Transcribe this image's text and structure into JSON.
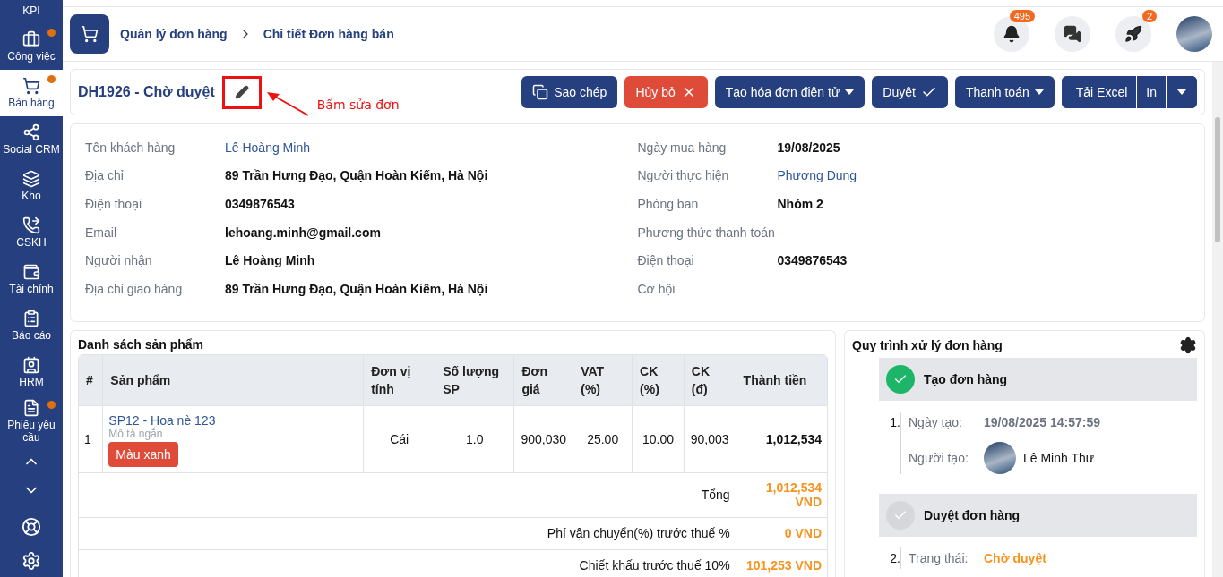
{
  "sidebar": {
    "items": [
      {
        "label": "KPI",
        "dot": false,
        "selected": false
      },
      {
        "label": "Công việc",
        "dot": true,
        "selected": false
      },
      {
        "label": "Bán hàng",
        "dot": true,
        "selected": true
      },
      {
        "label": "Social CRM",
        "dot": false,
        "selected": false
      },
      {
        "label": "Kho",
        "dot": false,
        "selected": false
      },
      {
        "label": "CSKH",
        "dot": false,
        "selected": false
      },
      {
        "label": "Tài chính",
        "dot": false,
        "selected": false
      },
      {
        "label": "Báo cáo",
        "dot": false,
        "selected": false
      },
      {
        "label": "HRM",
        "dot": false,
        "selected": false
      },
      {
        "label": "Phiếu yêu cầu",
        "dot": true,
        "selected": false
      }
    ]
  },
  "breadcrumb": [
    "Quản lý đơn hàng",
    "Chi tiết Đơn hàng bán"
  ],
  "header": {
    "notifications": "495",
    "rocket_count": "2"
  },
  "order": {
    "title": "DH1926 - Chờ duyệt",
    "annotation": "Bấm sửa đơn",
    "actions": [
      {
        "label": "Sao chép",
        "kind": "copy"
      },
      {
        "label": "Hủy bỏ",
        "kind": "cancel"
      },
      {
        "label": "Tạo hóa đơn điện tử",
        "kind": "dropdown"
      },
      {
        "label": "Duyệt",
        "kind": "approve"
      },
      {
        "label": "Thanh toán",
        "kind": "dropdown"
      }
    ],
    "export": [
      "Tải Excel",
      "In"
    ]
  },
  "info": {
    "left": [
      {
        "label": "Tên khách hàng",
        "value": "Lê Hoàng Minh",
        "kind": "link"
      },
      {
        "label": "Địa chỉ",
        "value": "89 Trần Hưng Đạo, Quận Hoàn Kiếm, Hà Nội",
        "kind": "bold"
      },
      {
        "label": "Điện thoại",
        "value": "0349876543",
        "kind": "bold"
      },
      {
        "label": "Email",
        "value": "lehoang.minh@gmail.com",
        "kind": "bold"
      },
      {
        "label": "Người nhận",
        "value": "Lê Hoàng Minh",
        "kind": "bold"
      },
      {
        "label": "Địa chỉ giao hàng",
        "value": "89 Trần Hưng Đạo, Quận Hoàn Kiếm, Hà Nội",
        "kind": "bold"
      }
    ],
    "right": [
      {
        "label": "Ngày mua hàng",
        "value": "19/08/2025",
        "kind": "bold"
      },
      {
        "label": "Người thực hiện",
        "value": "Phương Dung",
        "kind": "link"
      },
      {
        "label": "Phòng ban",
        "value": "Nhóm 2",
        "kind": "bold"
      },
      {
        "label": "Phương thức thanh toán",
        "kind": "empty"
      },
      {
        "label": "Điện thoại",
        "value": "0349876543",
        "kind": "bold"
      },
      {
        "label": "Cơ hội",
        "kind": "empty"
      }
    ]
  },
  "products": {
    "title": "Danh sách sản phẩm",
    "columns": [
      "#",
      "Sản phẩm",
      "Đơn vị tính",
      "Số lượng SP",
      "Đơn giá",
      "VAT (%)",
      "CK (%)",
      "CK (đ)",
      "Thành tiền"
    ],
    "rows": [
      {
        "index": "1",
        "name": "SP12 - Hoa nè 123",
        "description": "Mô tả ngắn",
        "tag": "Màu xanh",
        "unit": "Cái",
        "quantity": "1.0",
        "price": "900,030",
        "vat": "25.00",
        "discount_pct": "10.00",
        "discount_amount": "90,003",
        "total": "1,012,534"
      }
    ],
    "summary": [
      {
        "label": "Tổng",
        "value": "1,012,534 VND"
      },
      {
        "label": "Phí vận chuyển(%) trước thuế %",
        "value": "0 VND"
      },
      {
        "label": "Chiết khấu trước thuế 10%",
        "value": "101,253 VND"
      }
    ]
  },
  "process": {
    "title": "Quy trình xử lý đơn hàng",
    "steps": [
      {
        "title": "Tạo đơn hàng",
        "done": true,
        "number": "1.",
        "details": [
          {
            "label": "Ngày tạo:",
            "value": "19/08/2025 14:57:59",
            "kind": "date"
          },
          {
            "label": "Người tạo:",
            "value": "Lê Minh Thư",
            "kind": "person"
          }
        ]
      },
      {
        "title": "Duyệt đơn hàng",
        "done": false,
        "number": "2.",
        "details": [
          {
            "label": "Trạng thái:",
            "value": "Chờ duyệt",
            "kind": "status"
          }
        ]
      }
    ]
  }
}
